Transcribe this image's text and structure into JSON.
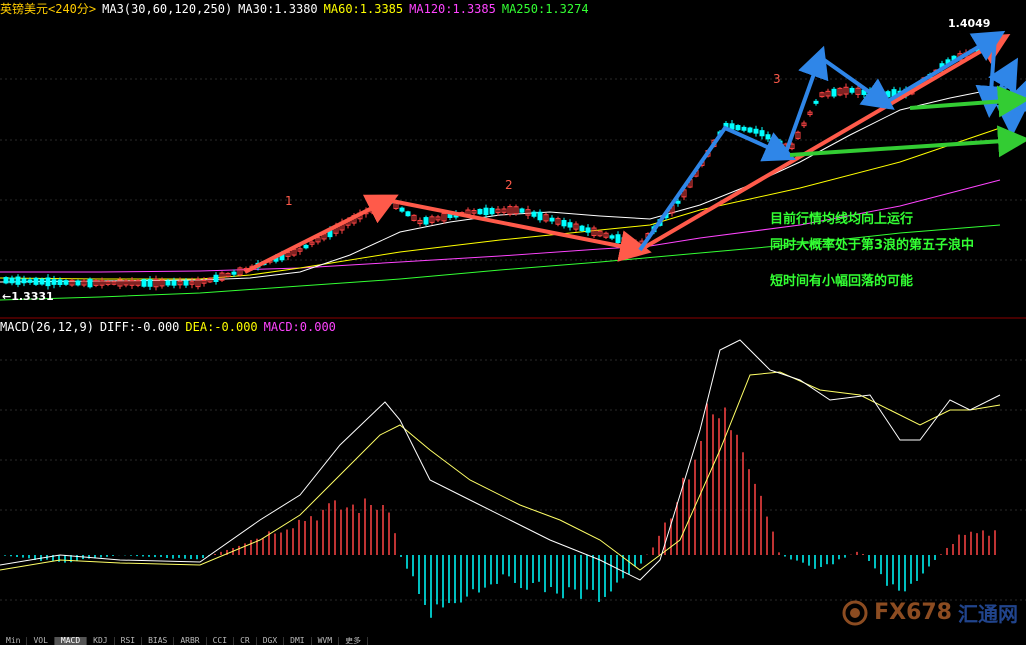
{
  "header": {
    "instrument": "英镑美元<240分>",
    "ma_set": "MA3(30,60,120,250)",
    "ma30": "MA30:1.3380",
    "ma60": "MA60:1.3385",
    "ma120": "MA120:1.3385",
    "ma250": "MA250:1.3274"
  },
  "price_labels": {
    "high": "1.4049",
    "low": "1.3331"
  },
  "waves": {
    "w1": "1",
    "w2": "2",
    "w3": "3"
  },
  "notes": {
    "line1": "目前行情均线均向上运行",
    "line2": "同时大概率处于第3浪的第五子浪中",
    "line3": "短时间有小幅回落的可能"
  },
  "macd_header": {
    "name": "MACD(26,12,9)",
    "diff": "DIFF:-0.000",
    "dea": "DEA:-0.000",
    "macd": "MACD:0.000"
  },
  "tabs": [
    "Min",
    "VOL",
    "MACD",
    "KDJ",
    "RSI",
    "BIAS",
    "ARBR",
    "CCI",
    "CR",
    "DGX",
    "DMI",
    "WVM",
    "更多"
  ],
  "active_tab": "MACD",
  "watermark": {
    "text": "FX678",
    "cn": "汇通网"
  },
  "colors": {
    "ma30": "#ffffff",
    "ma60": "#ffff00",
    "ma120": "#ff44ff",
    "ma250": "#33ff33",
    "up": "#ff4444",
    "down": "#00ffff",
    "red_arrow": "#ff5a4a",
    "blue_arrow": "#2f86e8",
    "green_line": "#33cc33"
  }
}
